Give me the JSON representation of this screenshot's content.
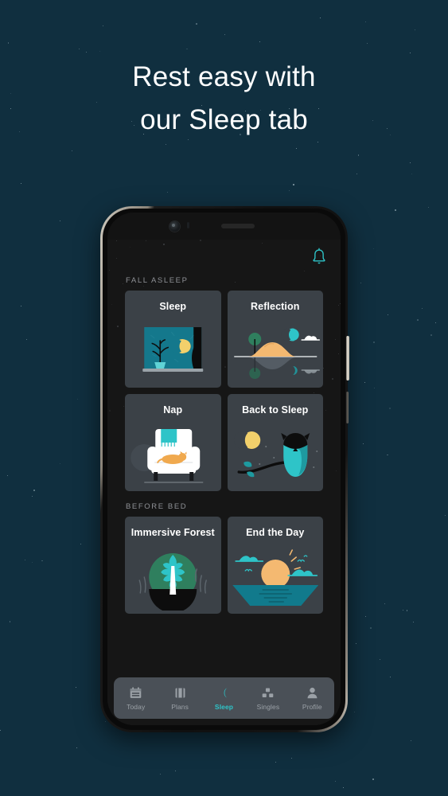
{
  "page": {
    "background_color": "#102f3f",
    "headline_line1": "Rest easy with",
    "headline_line2": "our Sleep tab"
  },
  "accent_color": "#2ec4c8",
  "device": {
    "frame_color": "#101010",
    "camera_icon": "front-camera",
    "speaker_icon": "earpiece-speaker"
  },
  "app": {
    "background_color": "#161616",
    "appbar": {
      "notification_icon": "bell-icon",
      "notification_color": "#2ec4c8"
    },
    "sections": [
      {
        "label": "FALL ASLEEP",
        "cards": [
          {
            "title": "Sleep",
            "art": "window-night-moon-plant"
          },
          {
            "title": "Reflection",
            "art": "island-hill-reflection"
          },
          {
            "title": "Nap",
            "art": "armchair-cat"
          },
          {
            "title": "Back to Sleep",
            "art": "owl-branch-moon"
          }
        ]
      },
      {
        "label": "BEFORE BED",
        "cards": [
          {
            "title": "Immersive Forest",
            "art": "leaf-green-circle"
          },
          {
            "title": "End the Day",
            "art": "sunset-over-water"
          }
        ]
      }
    ],
    "nav": {
      "items": [
        {
          "label": "Today",
          "icon": "calendar-icon",
          "active": false
        },
        {
          "label": "Plans",
          "icon": "book-icon",
          "active": false
        },
        {
          "label": "Sleep",
          "icon": "moon-icon",
          "active": true
        },
        {
          "label": "Singles",
          "icon": "grid-icon",
          "active": false
        },
        {
          "label": "Profile",
          "icon": "person-icon",
          "active": false
        }
      ]
    }
  }
}
